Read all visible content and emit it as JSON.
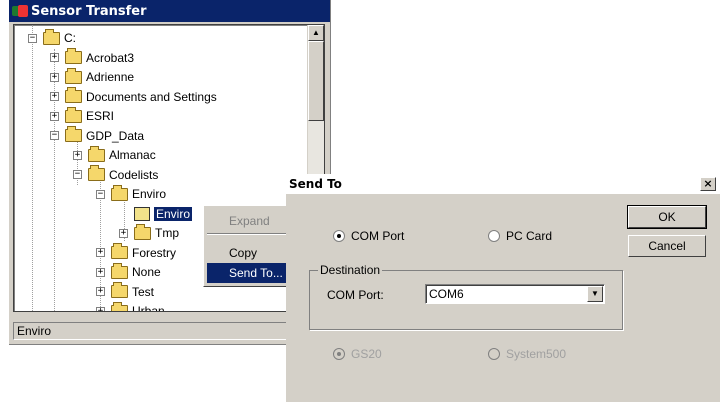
{
  "sensor_window": {
    "title": "Sensor Transfer",
    "status_text": "Enviro",
    "tree": [
      {
        "label": "C:",
        "expander": "−",
        "depth": 0
      },
      {
        "label": "Acrobat3",
        "expander": "+",
        "depth": 1
      },
      {
        "label": "Adrienne",
        "expander": "+",
        "depth": 1
      },
      {
        "label": "Documents and Settings",
        "expander": "+",
        "depth": 1
      },
      {
        "label": "ESRI",
        "expander": "+",
        "depth": 1
      },
      {
        "label": "GDP_Data",
        "expander": "−",
        "depth": 1
      },
      {
        "label": "Almanac",
        "expander": "+",
        "depth": 2
      },
      {
        "label": "Codelists",
        "expander": "−",
        "depth": 2
      },
      {
        "label": "Enviro",
        "expander": "−",
        "depth": 3
      },
      {
        "label": "Enviro",
        "expander": "",
        "depth": 4,
        "selected": true
      },
      {
        "label": "Tmp",
        "expander": "+",
        "depth": 4
      },
      {
        "label": "Forestry",
        "expander": "+",
        "depth": 3
      },
      {
        "label": "None",
        "expander": "+",
        "depth": 3
      },
      {
        "label": "Test",
        "expander": "+",
        "depth": 3
      },
      {
        "label": "Urban",
        "expander": "+",
        "depth": 3
      }
    ]
  },
  "context_menu": {
    "items": [
      {
        "label": "Expand",
        "disabled": true
      },
      {
        "label": "Copy",
        "disabled": false
      },
      {
        "label": "Send To...",
        "highlighted": true
      }
    ]
  },
  "send_to_dialog": {
    "title": "Send To",
    "close_glyph": "×",
    "ok_label": "OK",
    "cancel_label": "Cancel",
    "port_options": [
      {
        "label": "COM Port",
        "selected": true
      },
      {
        "label": "PC Card",
        "selected": false
      }
    ],
    "destination_label": "Destination",
    "com_port_label": "COM Port:",
    "com_port_value": "COM6",
    "device_options": [
      {
        "label": "GS20",
        "selected": true,
        "disabled": true
      },
      {
        "label": "System500",
        "selected": false,
        "disabled": true
      }
    ]
  },
  "colors": {
    "titlebar_active": "#0a246a",
    "dialog_face": "#d4d0c8",
    "selection": "#0a246a"
  }
}
